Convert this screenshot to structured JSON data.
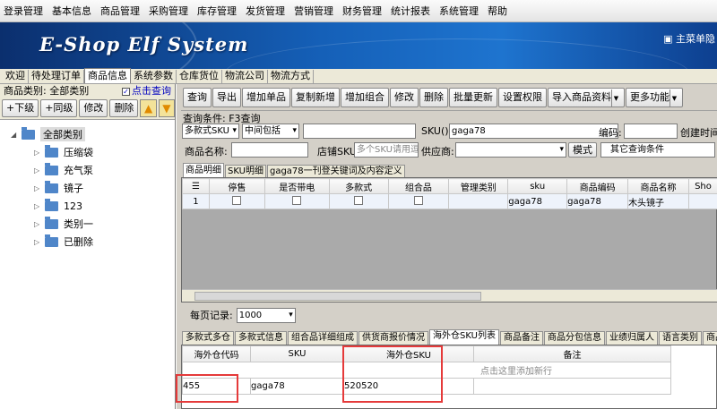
{
  "menubar": [
    "登录管理",
    "基本信息",
    "商品管理",
    "采购管理",
    "库存管理",
    "发货管理",
    "营销管理",
    "财务管理",
    "统计报表",
    "系统管理",
    "帮助"
  ],
  "banner": {
    "logo": "E-Shop Elf System",
    "home": "主菜单隐"
  },
  "tabs": [
    "欢迎",
    "待处理订单",
    "商品信息",
    "系统参数",
    "仓库货位",
    "物流公司",
    "物流方式"
  ],
  "active_tab_index": 2,
  "left": {
    "category_label": "商品类别: 全部类别",
    "click_query": "点击查询",
    "buttons": [
      "+下级",
      "+同级",
      "修改",
      "删除"
    ],
    "root": "全部类别",
    "children": [
      "压缩袋",
      "充气泵",
      "镜子",
      "123",
      "类别一",
      "已删除"
    ]
  },
  "toolbar": {
    "buttons": [
      "查询",
      "导出",
      "增加单品",
      "复制新增",
      "增加组合",
      "修改",
      "删除",
      "批量更新",
      "设置权限",
      "导入商品资料",
      "更多功能"
    ]
  },
  "query": {
    "title": "查询条件: F3查询",
    "multi_sku": "多款式SKU",
    "match": "中间包括",
    "sku_label": "SKU():",
    "sku_value": "gaga78",
    "code_label": "编码:",
    "created_label": "创建时间",
    "name_label": "商品名称:",
    "shop_sku_label": "店铺SKU:",
    "shop_sku_placeholder": "多个SKU请用逗号",
    "supplier_label": "供应商:",
    "mode_btn": "模式",
    "other_cond": "其它查询条件"
  },
  "main_tabs": [
    "商品明细",
    "SKU明细",
    "gaga78一刊登关键词及内容定义"
  ],
  "grid1": {
    "columns": [
      "",
      "停售",
      "是否带电",
      "多款式",
      "组合品",
      "管理类别",
      "sku",
      "商品编码",
      "商品名称",
      "Sho"
    ],
    "rows": [
      {
        "n": "1",
        "sku": "gaga78",
        "code": "gaga78",
        "name": "木头镜子"
      }
    ]
  },
  "perpage": {
    "label": "每页记录:",
    "value": "1000"
  },
  "bottom_tabs": [
    "多款式多仓",
    "多款式信息",
    "组合品详细组成",
    "供货商报价情况",
    "海外仓SKU列表",
    "商品备注",
    "商品分包信息",
    "业绩归属人",
    "语言类别",
    "商品"
  ],
  "bottom_active_index": 4,
  "grid2": {
    "columns": [
      "海外仓代码",
      "SKU",
      "海外仓SKU",
      "备注"
    ],
    "add_hint": "点击这里添加新行",
    "row": {
      "code": "455",
      "sku": "gaga78",
      "wsku": "520520",
      "note": ""
    }
  },
  "colors": {
    "highlight": "#e53a3a",
    "banner": "#1560b8"
  }
}
